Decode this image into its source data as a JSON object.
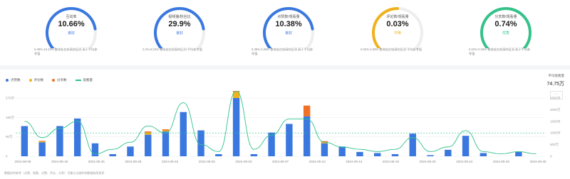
{
  "gauges": [
    {
      "title": "互动率",
      "value": "10.66%",
      "level": "良好",
      "desc": "6.38%-10.23% 整体处在较高的区间 高于平均参考值",
      "color": "#3a78e0",
      "fraction": 0.75
    },
    {
      "title": "视频播/粉丝比",
      "value": "29.9%",
      "level": "良好",
      "desc": "2.3%-9.03% 整体处在较高的区间 平均参考值",
      "color": "#3a78e0",
      "fraction": 0.75
    },
    {
      "title": "点赞数/观看量",
      "value": "10.38%",
      "level": "良好",
      "desc": "5.38%-6.08% 整体处在较高的区间 高于平均参考值",
      "color": "#3a78e0",
      "fraction": 0.75
    },
    {
      "title": "评论数/观看量",
      "value": "0.03%",
      "level": "中等",
      "desc": "0.03%-0.08% 整体处在较高的区间 平均参考值",
      "color": "#f0b21c",
      "fraction": 0.5
    },
    {
      "title": "分享数/观看量",
      "value": "0.74%",
      "level": "优秀",
      "desc": "0.02%-0.09% 整体处在较高的区间 高于平均参考值",
      "color": "#35c28a",
      "fraction": 0.92
    }
  ],
  "legend": [
    {
      "label": "点赞数",
      "color": "#3a78e0",
      "kind": "dot"
    },
    {
      "label": "评论数",
      "color": "#f0b21c",
      "kind": "dot"
    },
    {
      "label": "分享数",
      "color": "#f07026",
      "kind": "dot"
    },
    {
      "label": "观看量",
      "color": "#2fc28a",
      "kind": "line"
    }
  ],
  "stat": {
    "label": "平均观看量",
    "value": "74.75万",
    "more": "···"
  },
  "footnote": "数据仅供参考（点赞、观看、点赞、评论、分享）· 可能与当前时刻数据有所差异",
  "chart_data": {
    "type": "bar",
    "dates": [
      "2024-08-08",
      "2024-08-19",
      "2024-08-26",
      "2024-08-29",
      "2024-09-02",
      "2024-09-03",
      "2024-09-03",
      "2024-09-07",
      "2024-09-10",
      "2024-09-13",
      "2024-09-19",
      "2024-09-20",
      "2024-09-24",
      "2024-09-25",
      "2024-09-28"
    ],
    "likes": [
      140,
      65,
      140,
      175,
      60,
      10,
      45,
      100,
      115,
      205,
      120,
      10,
      270,
      10,
      110,
      150,
      185,
      60,
      45,
      20,
      15,
      10,
      105,
      5,
      30,
      95,
      15,
      0,
      20,
      0
    ],
    "comments": [
      0,
      5,
      0,
      0,
      0,
      0,
      0,
      10,
      5,
      0,
      0,
      0,
      30,
      0,
      0,
      0,
      0,
      5,
      0,
      0,
      0,
      0,
      0,
      0,
      0,
      0,
      0,
      0,
      0,
      0
    ],
    "shares": [
      0,
      2,
      0,
      0,
      0,
      0,
      0,
      5,
      5,
      0,
      0,
      0,
      20,
      0,
      0,
      0,
      50,
      5,
      0,
      0,
      0,
      0,
      0,
      0,
      0,
      0,
      0,
      0,
      0,
      0
    ],
    "views": [
      1500,
      800,
      1200,
      1500,
      100,
      300,
      600,
      1300,
      1000,
      2300,
      500,
      200,
      2800,
      300,
      900,
      1600,
      1600,
      600,
      400,
      300,
      200,
      300,
      800,
      200,
      400,
      1100,
      200,
      100,
      200,
      100
    ],
    "avg_views": 1000,
    "y_left_ticks": [
      "0",
      "90万",
      "180万",
      "270万"
    ],
    "y_right_ticks": [
      "0",
      "500万",
      "1000万",
      "1500万",
      "2000万",
      "2500万"
    ],
    "y_left_max": 270,
    "y_right_max": 2500
  }
}
